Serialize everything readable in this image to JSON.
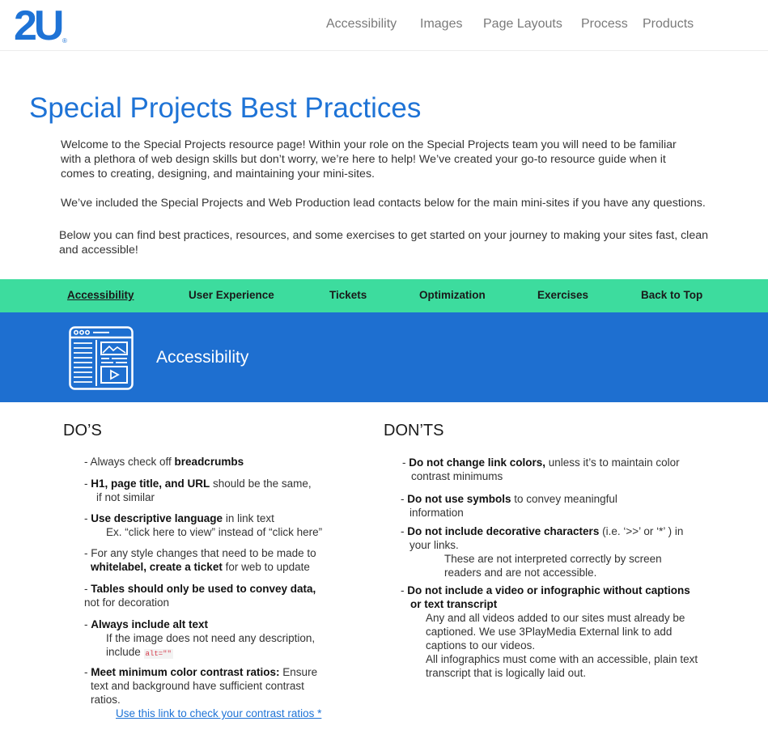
{
  "header": {
    "logo_text": "2U",
    "logo_reg": "®",
    "nav": [
      "Accessibility",
      "Images",
      "Page Layouts",
      "Process",
      "Products"
    ]
  },
  "page_title": "Special Projects Best Practices",
  "intro": {
    "p1": "Welcome to the Special Projects resource page! Within your role on the Special Projects team you will need to be familiar with a plethora of web design skills but don’t worry, we’re here to help! We’ve created your go-to resource guide when it comes to creating, designing, and maintaining your mini-sites.",
    "p2": "We’ve included the Special Projects and Web Production lead contacts below for the main mini-sites if you have any questions.",
    "p3": "Below you can find best practices, resources, and some exercises to get started on your journey to making your sites fast, clean and accessible!"
  },
  "tabs": [
    "Accessibility",
    "User Experience",
    "Tickets",
    "Optimization",
    "Exercises",
    "Back to Top"
  ],
  "banner": {
    "title": "Accessibility",
    "icon": "webpage-layout-icon"
  },
  "dos": {
    "heading": "DO’S",
    "i1": {
      "pre": "-  Always check off ",
      "bold": "breadcrumbs"
    },
    "i2": {
      "pre": "-  ",
      "bold": "H1, page title, and URL",
      "post": " should be the same,",
      "line2": "if not similar"
    },
    "i3": {
      "pre": "- ",
      "bold": "Use descriptive language",
      "post": " in link text",
      "line2": "Ex. “click here to view” instead of “click here”"
    },
    "i4": {
      "line1": "- For any style changes that need to be made to",
      "bold": "whitelabel, create a ticket",
      "post": " for web to update"
    },
    "i5": {
      "pre": "- ",
      "bold": "Tables should only be used to convey data,",
      "line2": "not for decoration"
    },
    "i6": {
      "pre": "- ",
      "bold": "Always include alt text",
      "line2": "If the image does not need any description,",
      "line3": "include ",
      "code": "alt=\"\""
    },
    "i7": {
      "pre": "- ",
      "bold": "Meet minimum color contrast ratios:",
      "post": " Ensure",
      "line2": "text and background have sufficient contrast",
      "line3": "ratios.",
      "link": "Use this link to check your contrast ratios *"
    }
  },
  "donts": {
    "heading": "DON’TS",
    "i1": {
      "pre": "- ",
      "bold": "Do not change link colors,",
      "post": " unless it’s to maintain color",
      "line2": "contrast minimums"
    },
    "i2": {
      "pre": "- ",
      "bold": "Do not use symbols",
      "post": " to convey meaningful",
      "line2": "information"
    },
    "i3": {
      "pre": "- ",
      "bold": "Do not include decorative characters",
      "post": " (i.e. ‘>>’ or ‘*’ ) in",
      "line2": "your links.",
      "line3": "These are not interpreted correctly by screen",
      "line4": "readers and are not accessible."
    },
    "i4": {
      "pre": "- ",
      "bold": "Do not include a video or infographic without captions",
      "bold2": "or text transcript",
      "line3": "Any and all videos added to our sites must already be",
      "line4": "captioned. We use 3PlayMedia External link to add",
      "line5": "captions to our videos.",
      "line6": "All infographics must come with an accessible, plain text",
      "line7": "transcript that is logically laid out."
    }
  }
}
